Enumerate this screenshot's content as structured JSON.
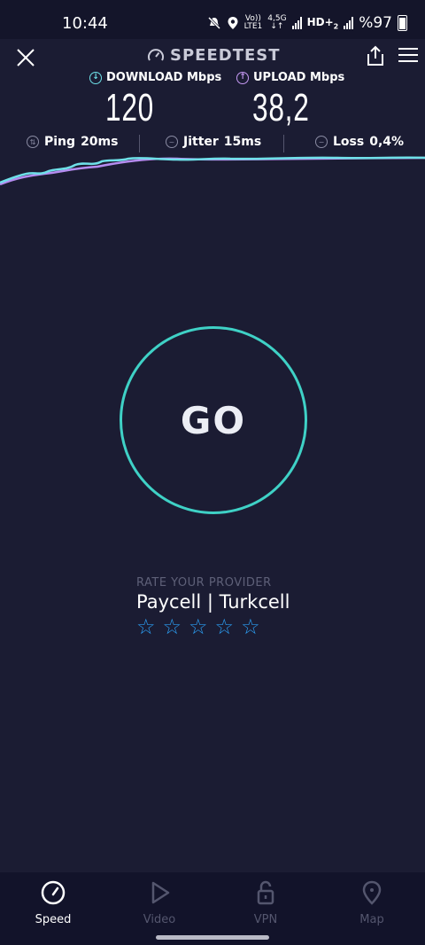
{
  "status_bar": {
    "time": "10:44",
    "net_top": "Vo))",
    "net_bottom": "LTE1",
    "net_type": "4,5G",
    "hd": "HD+",
    "hd_sub": "2",
    "battery": "%97"
  },
  "header": {
    "title": "SPEEDTEST"
  },
  "metrics": {
    "download_label": "DOWNLOAD Mbps",
    "download_value": "120",
    "upload_label": "UPLOAD Mbps",
    "upload_value": "38,2"
  },
  "stats": {
    "ping_label": "Ping",
    "ping_value": "20ms",
    "jitter_label": "Jitter",
    "jitter_value": "15ms",
    "loss_label": "Loss",
    "loss_value": "0,4%"
  },
  "colors": {
    "download": "#6ee0e8",
    "upload": "#c79af5",
    "accent": "#3fd1c6",
    "stars": "#2b9bef",
    "background": "#1b1c33"
  },
  "go_label": "GO",
  "rate": {
    "caption": "RATE YOUR PROVIDER",
    "provider": "Paycell | Turkcell",
    "stars": 5
  },
  "nav": {
    "speed": "Speed",
    "video": "Video",
    "vpn": "VPN",
    "map": "Map"
  }
}
